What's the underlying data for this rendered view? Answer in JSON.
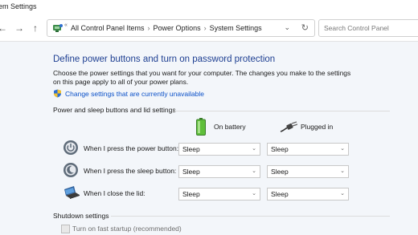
{
  "window": {
    "title": "em Settings"
  },
  "nav": {
    "back_glyph": "←",
    "forward_glyph": "→",
    "up_glyph": "↑",
    "address_small": "«",
    "breadcrumbs": [
      "All Control Panel Items",
      "Power Options",
      "System Settings"
    ],
    "separator": "›",
    "dropdown_glyph": "⌄",
    "refresh_glyph": "↻",
    "search_placeholder": "Search Control Panel"
  },
  "main": {
    "heading": "Define power buttons and turn on password protection",
    "description": "Choose the power settings that you want for your computer. The changes you make to the settings on this page apply to all of your power plans.",
    "change_link": "Change settings that are currently unavailable",
    "group_title": "Power and sleep buttons and lid settings",
    "columns": {
      "battery": "On battery",
      "plugged": "Plugged in"
    },
    "rows": [
      {
        "label": "When I press the power button:",
        "battery": "Sleep",
        "plugged": "Sleep"
      },
      {
        "label": "When I press the sleep button:",
        "battery": "Sleep",
        "plugged": "Sleep"
      },
      {
        "label": "When I close the lid:",
        "battery": "Sleep",
        "plugged": "Sleep"
      }
    ],
    "shutdown_title": "Shutdown settings",
    "fast_startup": "Turn on fast startup (recommended)",
    "select_arrow": "⌄"
  },
  "colors": {
    "heading": "#1e3f92",
    "link": "#0a50c8",
    "content_bg": "#f3f6fa"
  }
}
